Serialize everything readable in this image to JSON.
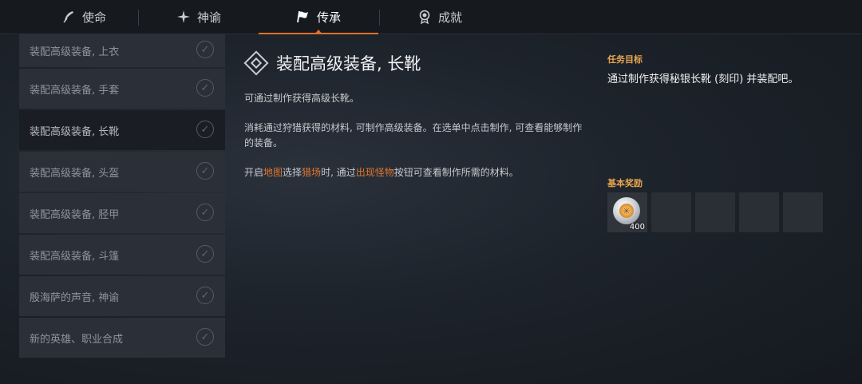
{
  "tabs": [
    {
      "label": "使命",
      "icon": "quill-icon"
    },
    {
      "label": "神谕",
      "icon": "star-burst-icon"
    },
    {
      "label": "传承",
      "icon": "flag-icon"
    },
    {
      "label": "成就",
      "icon": "medal-icon"
    }
  ],
  "active_tab": "传承",
  "quests": [
    {
      "label": "装配高级装备, 上衣"
    },
    {
      "label": "装配高级装备, 手套"
    },
    {
      "label": "装配高级装备, 长靴"
    },
    {
      "label": "装配高级装备, 头盔"
    },
    {
      "label": "装配高级装备, 胫甲"
    },
    {
      "label": "装配高级装备, 斗篷"
    },
    {
      "label": "殷海萨的声音, 神谕"
    },
    {
      "label": "新的英雄、职业合成"
    }
  ],
  "selected_quest": "装配高级装备, 长靴",
  "detail": {
    "title": "装配高级装备, 长靴",
    "p1": "可通过制作获得高级长靴。",
    "p2": "消耗通过狩猎获得的材料, 可制作高级装备。在选单中点击制作, 可查看能够制作的装备。",
    "p3": {
      "t1": "开启",
      "h1": "地图",
      "t2": "选择",
      "h2": "猎场",
      "t3": "时, 通过",
      "h3": "出现怪物",
      "t4": "按钮可查看制作所需的材料。"
    }
  },
  "objective": {
    "label": "任务目标",
    "text": "通过制作获得秘银长靴 (刻印) 并装配吧。"
  },
  "rewards": {
    "label": "基本奖励",
    "items": [
      {
        "icon": "silver-coin-icon",
        "qty": "400"
      }
    ],
    "empty_slots": 4
  },
  "colors": {
    "accent": "#e0702a",
    "highlight_text": "#e0762f",
    "section_label": "#e8a450"
  }
}
